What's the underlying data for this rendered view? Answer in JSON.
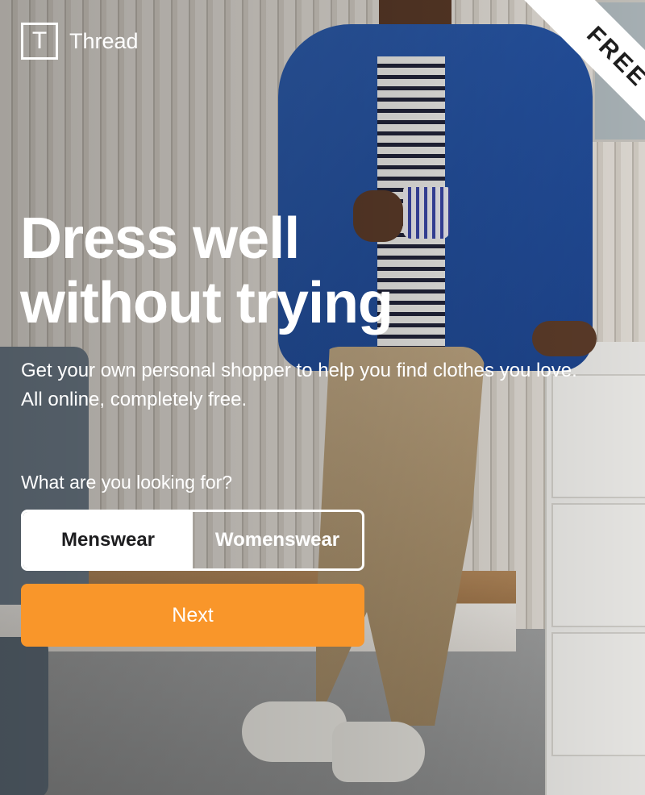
{
  "brand": {
    "logo_letter": "T",
    "name": "Thread"
  },
  "ribbon": {
    "label": "FREE"
  },
  "hero": {
    "headline_line1": "Dress well",
    "headline_line2": "without trying",
    "subtitle": "Get your own personal shopper to help you find clothes you love. All online, completely free."
  },
  "form": {
    "question": "What are you looking for?",
    "options": [
      {
        "label": "Menswear",
        "selected": true
      },
      {
        "label": "Womenswear",
        "selected": false
      }
    ],
    "next_label": "Next"
  },
  "colors": {
    "accent_button": "#f9962a",
    "text": "#ffffff"
  }
}
